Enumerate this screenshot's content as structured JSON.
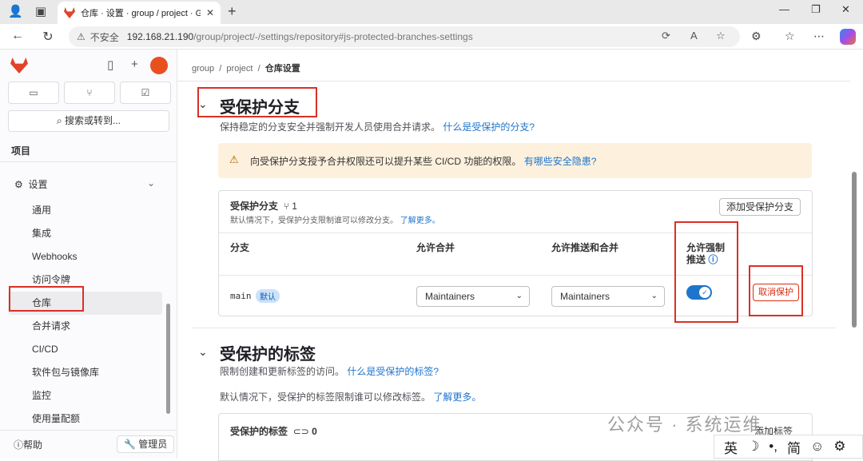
{
  "browser": {
    "tab_title": "仓库 · 设置 · group / project · Git",
    "url_warning": "不安全",
    "url_host": "192.168.21.190",
    "url_path": "/group/project/-/settings/repository#js-protected-branches-settings"
  },
  "sidebar": {
    "search": "搜索或转到...",
    "section": "项目",
    "settings_label": "设置",
    "items": [
      {
        "label": "通用"
      },
      {
        "label": "集成"
      },
      {
        "label": "Webhooks"
      },
      {
        "label": "访问令牌"
      },
      {
        "label": "仓库"
      },
      {
        "label": "合并请求"
      },
      {
        "label": "CI/CD"
      },
      {
        "label": "软件包与镜像库"
      },
      {
        "label": "监控"
      },
      {
        "label": "使用量配额"
      }
    ],
    "help": "帮助",
    "admin": "管理员"
  },
  "breadcrumb": {
    "group": "group",
    "project": "project",
    "current": "仓库设置"
  },
  "protected_branches": {
    "title": "受保护分支",
    "desc": "保持稳定的分支安全并强制开发人员使用合并请求。",
    "desc_link": "什么是受保护的分支?",
    "alert": "向受保护分支授予合并权限还可以提升某些 CI/CD 功能的权限。",
    "alert_link": "有哪些安全隐患?",
    "card_title": "受保护分支",
    "count": "1",
    "card_sub": "默认情况下，受保护分支限制谁可以修改分支。",
    "card_sub_link": "了解更多。",
    "add_button": "添加受保护分支",
    "headers": {
      "branch": "分支",
      "merge": "允许合并",
      "push_merge": "允许推送和合并",
      "force_push_1": "允许强制",
      "force_push_2": "推送"
    },
    "row": {
      "branch": "main",
      "badge": "默认",
      "merge": "Maintainers",
      "push_merge": "Maintainers",
      "force_push": true,
      "unprotect": "取消保护"
    }
  },
  "protected_tags": {
    "title": "受保护的标签",
    "desc": "限制创建和更新标签的访问。",
    "desc_link": "什么是受保护的标签?",
    "desc2": "默认情况下，受保护的标签限制谁可以修改标签。",
    "desc2_link": "了解更多。",
    "card_title": "受保护的标签",
    "count": "0",
    "add_button": "添加标签"
  },
  "watermark": "公众号 · 系统运维",
  "ime": {
    "lang": "英",
    "mode": "简"
  },
  "colors": {
    "accent": "#1f75cb",
    "highlight": "#d93025"
  }
}
